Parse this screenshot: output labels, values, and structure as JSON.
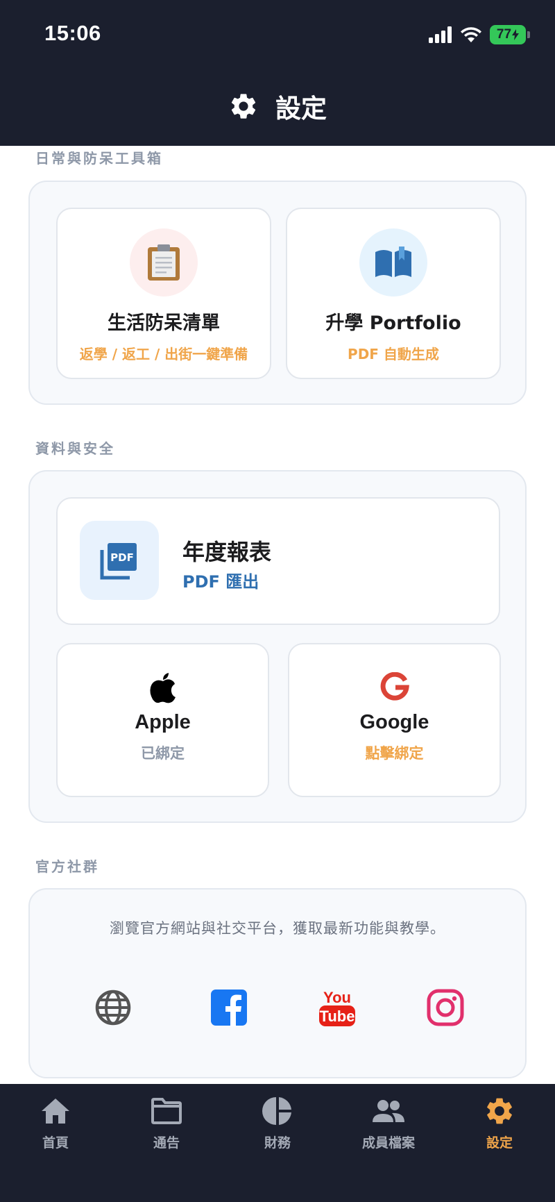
{
  "status_bar": {
    "time": "15:06",
    "battery": "77"
  },
  "header": {
    "title": "設定",
    "icon": "gear-icon"
  },
  "toolbox": {
    "label": "日常與防呆工具箱",
    "items": [
      {
        "title": "生活防呆清單",
        "subtitle": "返學 / 返工 / 出街一鍵準備",
        "icon": "clipboard-icon"
      },
      {
        "title": "升學 Portfolio",
        "subtitle": "PDF 自動生成",
        "icon": "open-book-icon"
      }
    ]
  },
  "data_security": {
    "label": "資料與安全",
    "report": {
      "title": "年度報表",
      "subtitle": "PDF 匯出",
      "icon": "pdf-icon"
    },
    "accounts": [
      {
        "title": "Apple",
        "status": "已綁定",
        "status_color": "#8e98a8",
        "icon": "apple-icon"
      },
      {
        "title": "Google",
        "status": "點擊綁定",
        "status_color": "#f0a54a",
        "icon": "google-icon"
      }
    ]
  },
  "community": {
    "label": "官方社群",
    "description": "瀏覽官方網站與社交平台，獲取最新功能與教學。",
    "links": [
      {
        "name": "website",
        "icon": "globe-icon"
      },
      {
        "name": "facebook",
        "icon": "facebook-icon"
      },
      {
        "name": "youtube",
        "icon": "youtube-icon",
        "text_top": "You",
        "text_bottom": "Tube"
      },
      {
        "name": "instagram",
        "icon": "instagram-icon"
      }
    ]
  },
  "tabbar": {
    "tabs": [
      {
        "label": "首頁",
        "icon": "home-icon"
      },
      {
        "label": "通告",
        "icon": "folder-icon"
      },
      {
        "label": "財務",
        "icon": "pie-chart-icon"
      },
      {
        "label": "成員檔案",
        "icon": "people-icon"
      },
      {
        "label": "設定",
        "icon": "gear-icon",
        "active": true
      }
    ]
  },
  "colors": {
    "header_bg": "#1b1f2e",
    "accent_orange": "#f0a54a",
    "link_blue": "#2f6fb0",
    "google_red": "#db4437",
    "facebook_blue": "#1877f2",
    "youtube_red": "#e62117",
    "instagram_pink": "#e1306c"
  }
}
